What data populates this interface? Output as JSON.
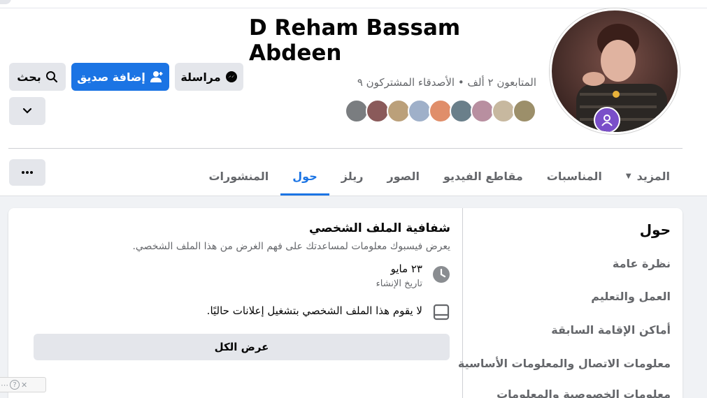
{
  "profile": {
    "name": "D Reham Bassam Abdeen",
    "meta": "المتابعون ٢ ألف • الأصدقاء المشتركون ٩",
    "friend_avatar_colors": [
      "#9c8f6a",
      "#c7b89f",
      "#b88fa0",
      "#6a7f8a",
      "#e08e6a",
      "#9fb0c9",
      "#bba07a",
      "#8a5a5a",
      "#7a7d80"
    ]
  },
  "actions": {
    "message_label": "مراسلة",
    "add_friend_label": "إضافة صديق",
    "search_label": "بحث"
  },
  "tabs": [
    {
      "label": "المنشورات",
      "active": false
    },
    {
      "label": "حول",
      "active": true
    },
    {
      "label": "ريلز",
      "active": false
    },
    {
      "label": "الصور",
      "active": false
    },
    {
      "label": "مقاطع الفيديو",
      "active": false
    },
    {
      "label": "المناسبات",
      "active": false
    },
    {
      "label": "المزيد",
      "active": false
    }
  ],
  "about": {
    "title": "حول",
    "items": [
      "نظرة عامة",
      "العمل والتعليم",
      "أماكن الإقامة السابقة",
      "معلومات الاتصال والمعلومات الأساسية",
      "معلومات الخصوصية والمعلومات"
    ]
  },
  "transparency": {
    "title": "شفافية الملف الشخصي",
    "description": "يعرض فيسبوك معلومات لمساعدتك على فهم الغرض من هذا الملف الشخصي.",
    "created_date": "٢٣ مايو",
    "created_label": "تاريخ الإنشاء",
    "ads_text": "لا يقوم هذا الملف الشخصي بتشغيل إعلانات حاليًا.",
    "see_all_label": "عرض الكل"
  },
  "colors": {
    "accent": "#1b74e4",
    "button_gray": "#e4e6eb",
    "page_bg": "#f0f2f5",
    "secondary_text": "#65676b",
    "badge": "#7a4fc9"
  },
  "icons": {
    "message": "messenger-icon",
    "add_friend": "add-friend-icon",
    "search": "search-icon",
    "dropdown": "chevron-down-icon",
    "more": "more-dots-icon",
    "clock": "clock-icon",
    "ads": "ad-monitor-icon"
  }
}
